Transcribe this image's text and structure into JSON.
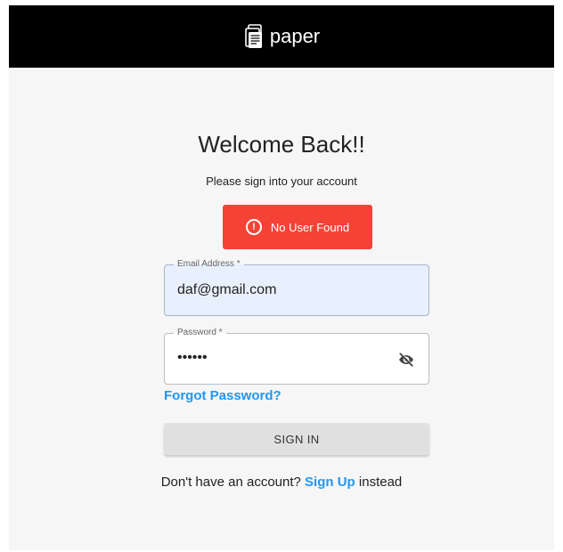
{
  "header": {
    "brand_name": "paper",
    "logo_icon": "document-stack-icon",
    "background": "#000000"
  },
  "login": {
    "title": "Welcome Back!!",
    "subtitle": "Please sign into your account",
    "alert": {
      "icon": "error-circle-icon",
      "message": "No User Found",
      "color": "#f44336"
    },
    "email": {
      "label": "Email Address *",
      "value": "daf@gmail.com"
    },
    "password": {
      "label": "Password *",
      "masked_value": "••••••",
      "toggle_icon": "eye-off-icon"
    },
    "forgot_link": "Forgot Password?",
    "signin_button": "SIGN IN",
    "signup_prompt": "Don't have an account?",
    "signup_link": "Sign Up",
    "signup_suffix": "instead",
    "link_color": "#2196f3"
  }
}
